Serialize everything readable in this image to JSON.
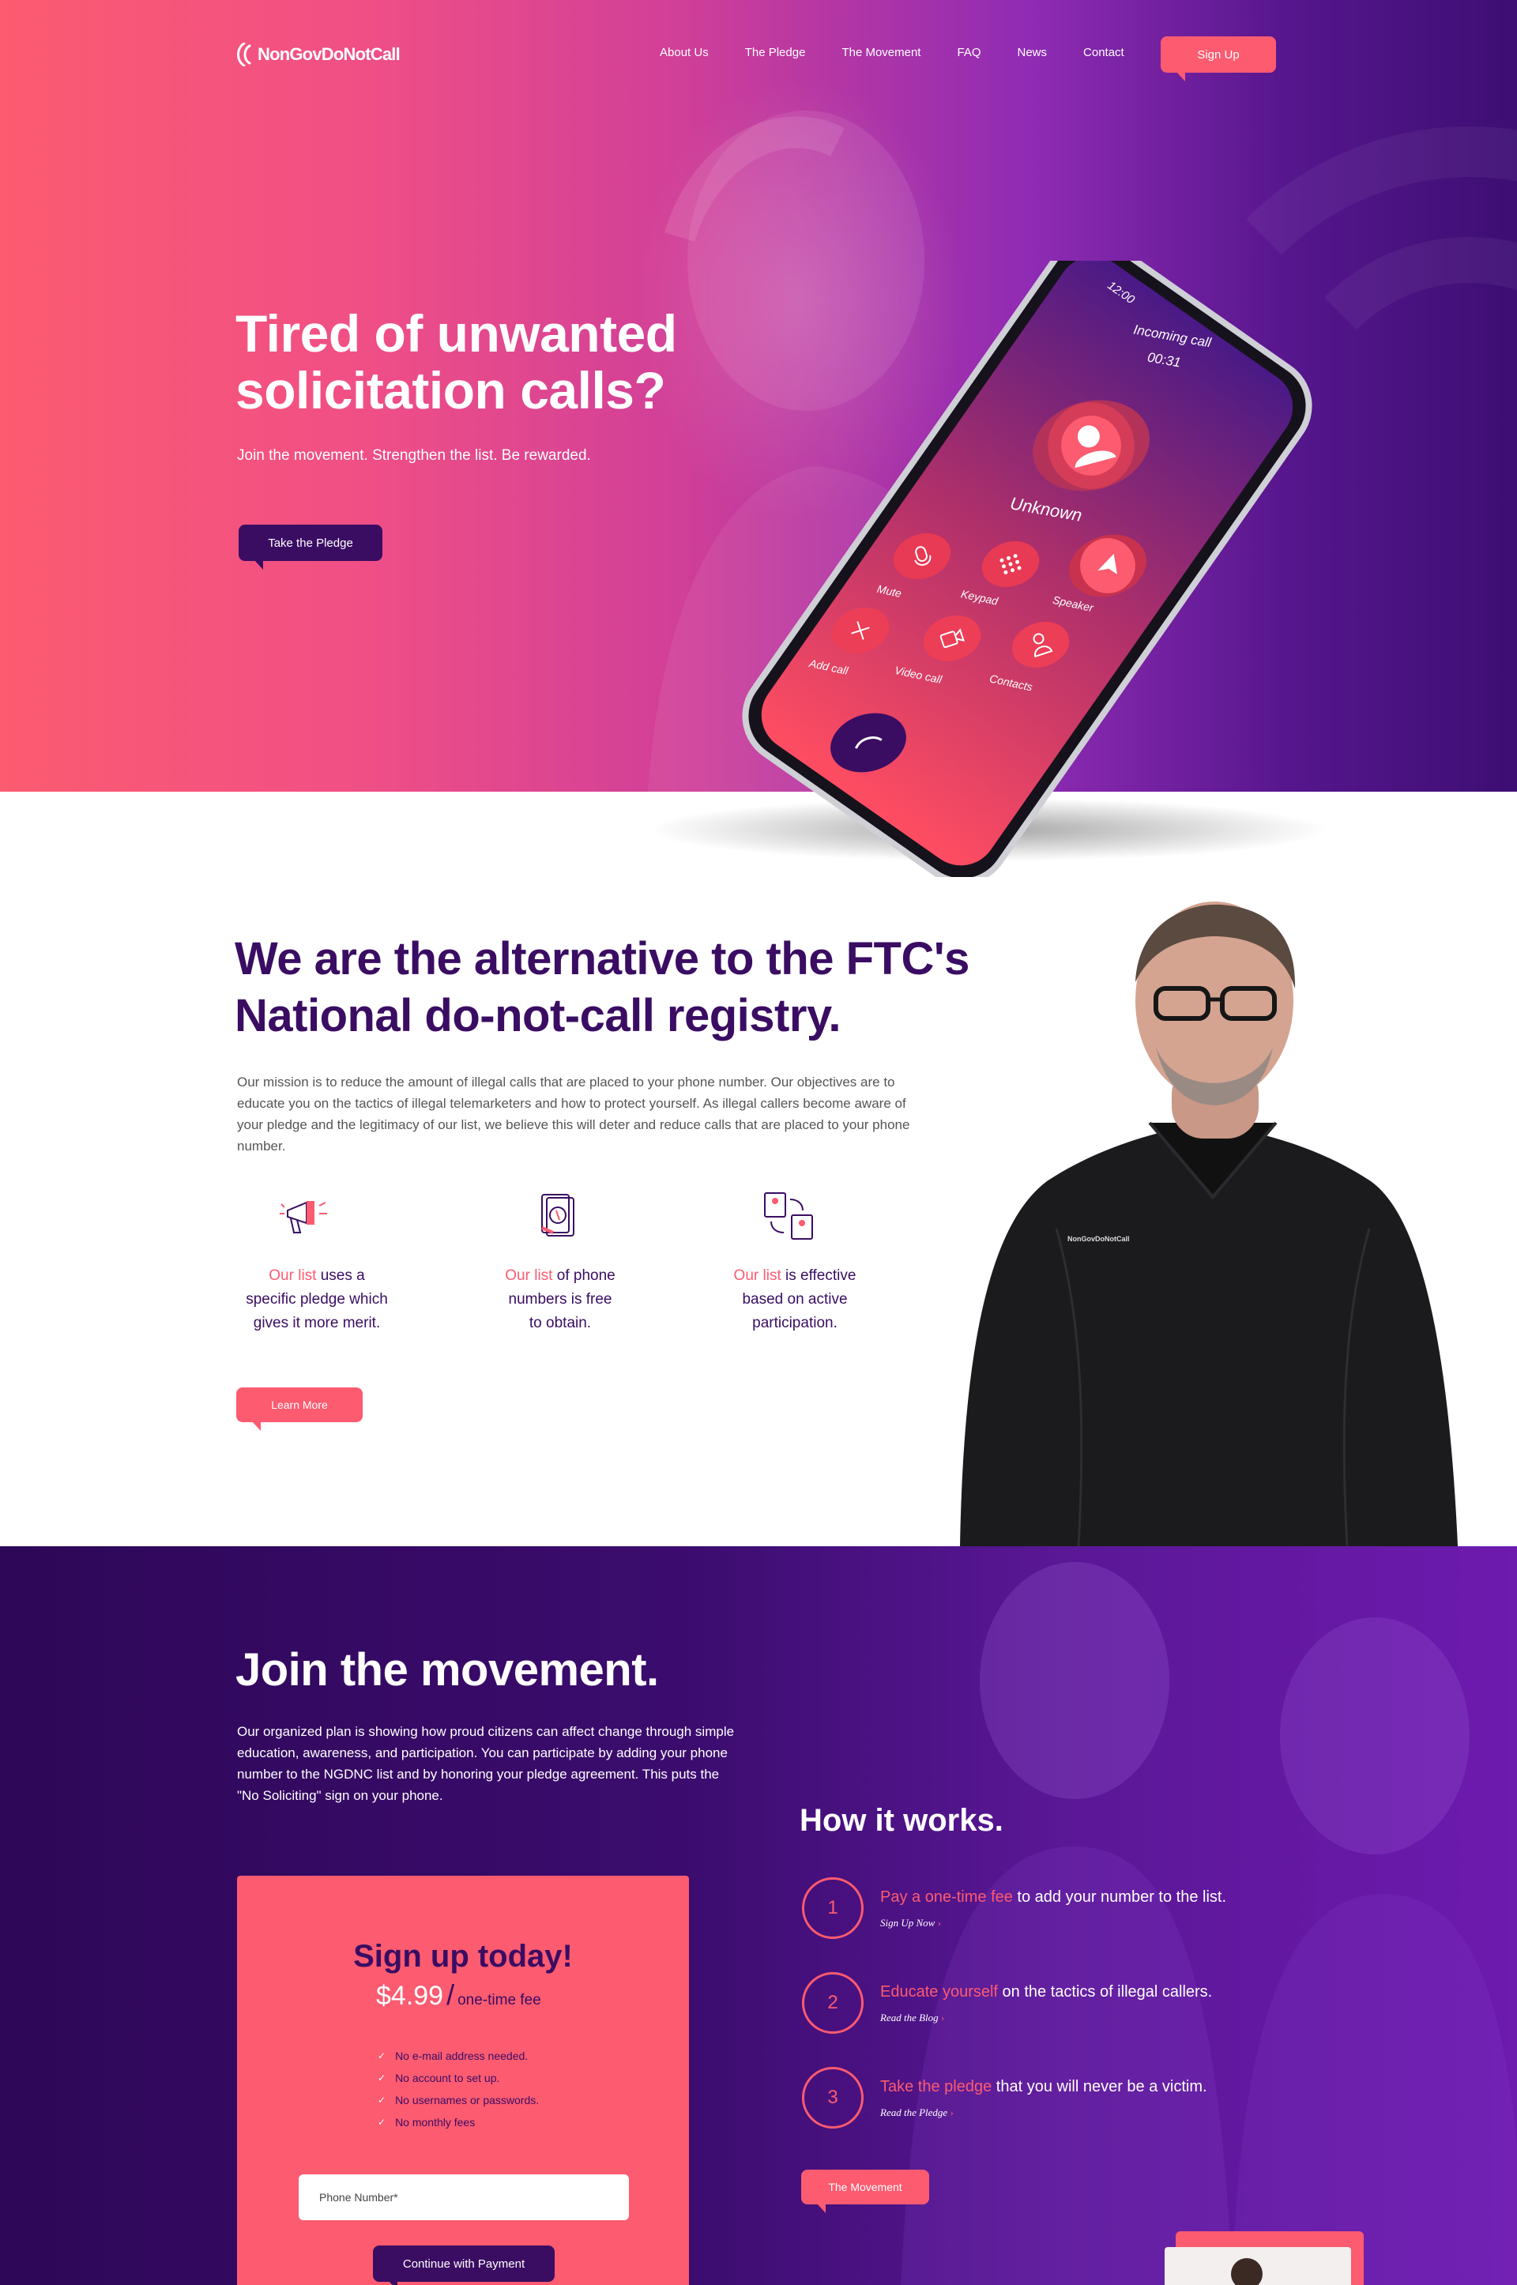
{
  "brand": {
    "name": "NonGovDoNotCall",
    "accent": "#fc5b70",
    "deep": "#3a0d63",
    "purple": "#6d1aae"
  },
  "nav": {
    "items": [
      "About Us",
      "The Pledge",
      "The Movement",
      "FAQ",
      "News",
      "Contact"
    ],
    "signup_label": "Sign Up"
  },
  "hero": {
    "title_line1": "Tired of unwanted",
    "title_line2": "solicitation calls?",
    "subtitle": "Join the movement. Strengthen the list. Be rewarded.",
    "cta_label": "Take the Pledge",
    "phone_screen": {
      "time": "12:00",
      "call_label": "Incoming call",
      "duration": "00:31",
      "caller": "Unknown",
      "actions": [
        "Mute",
        "Keypad",
        "Speaker",
        "Add call",
        "Video call",
        "Contacts"
      ]
    }
  },
  "about": {
    "title_line1": "We are the alternative to the FTC's",
    "title_line2": "National do-not-call registry.",
    "body": "Our mission is to reduce the amount of illegal calls that are placed to your phone number. Our objectives are to educate you on the tactics of illegal telemarketers and how to protect yourself. As illegal callers become aware of your pledge and the legitimacy of our list, we believe this will deter and reduce calls that are placed to your phone number.",
    "features": [
      {
        "highlight": "Our list",
        "line1": " uses a",
        "line2": "specific pledge which",
        "line3": "gives it more merit.",
        "icon": "megaphone-icon"
      },
      {
        "highlight": "Our list",
        "line1": " of phone",
        "line2": "numbers is free",
        "line3": "to obtain.",
        "icon": "free-list-icon"
      },
      {
        "highlight": "Our list",
        "line1": " is effective",
        "line2": "based on active",
        "line3": "participation.",
        "icon": "participation-icon"
      }
    ],
    "cta_label": "Learn More",
    "shirt_logo": "NonGovDoNotCall"
  },
  "movement": {
    "title": "Join the movement.",
    "body": "Our organized plan is showing how proud citizens can affect change through simple education, awareness, and participation. You can participate by adding your phone number to the NGDNC list and by honoring your pledge agreement. This puts the \"No Soliciting\" sign on your phone.",
    "how_title": "How it works.",
    "steps": [
      {
        "num": "1",
        "highlight": "Pay a one-time fee",
        "rest": " to add your number to the list.",
        "link": "Sign Up Now"
      },
      {
        "num": "2",
        "highlight": "Educate yourself",
        "rest": " on the tactics of illegal callers.",
        "link": "Read the Blog"
      },
      {
        "num": "3",
        "highlight": "Take the pledge",
        "rest": " that you will never be a victim.",
        "link": "Read the Pledge"
      }
    ],
    "cta_label": "The Movement"
  },
  "signup": {
    "title": "Sign up today!",
    "price": "$4.99",
    "price_unit": "one-time fee",
    "benefits": [
      "No e-mail address needed.",
      "No account to set up.",
      "No usernames or passwords.",
      "No monthly fees"
    ],
    "phone_placeholder": "Phone Number*",
    "submit_label": "Continue with Payment"
  }
}
